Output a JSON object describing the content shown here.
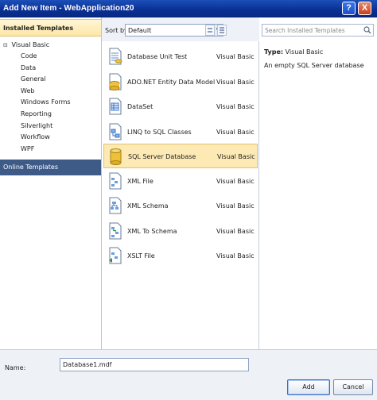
{
  "window": {
    "title": "Add New Item - WebApplication20",
    "help_label": "?",
    "close_label": "X"
  },
  "left": {
    "installed_header": "Installed Templates",
    "tree_root": "Visual Basic",
    "tree_toggle": "⊟",
    "tree_items": [
      "Code",
      "Data",
      "General",
      "Web",
      "Windows Forms",
      "Reporting",
      "Silverlight",
      "Workflow",
      "WPF"
    ],
    "online_templates": "Online Templates"
  },
  "toolbar": {
    "sort_label": "Sort by:",
    "sort_value": "Default",
    "dropdown_glyph": "▼"
  },
  "templates": [
    {
      "name": "Database Unit Test",
      "lang": "Visual Basic",
      "icon": "database-unit-test-icon"
    },
    {
      "name": "ADO.NET Entity Data Model",
      "lang": "Visual Basic",
      "icon": "entity-model-icon"
    },
    {
      "name": "DataSet",
      "lang": "Visual Basic",
      "icon": "dataset-icon"
    },
    {
      "name": "LINQ to SQL Classes",
      "lang": "Visual Basic",
      "icon": "linq-icon"
    },
    {
      "name": "SQL Server Database",
      "lang": "Visual Basic",
      "icon": "sql-database-icon",
      "selected": true
    },
    {
      "name": "XML File",
      "lang": "Visual Basic",
      "icon": "xml-file-icon"
    },
    {
      "name": "XML Schema",
      "lang": "Visual Basic",
      "icon": "xml-schema-icon"
    },
    {
      "name": "XML To Schema",
      "lang": "Visual Basic",
      "icon": "xml-to-schema-icon"
    },
    {
      "name": "XSLT File",
      "lang": "Visual Basic",
      "icon": "xslt-file-icon"
    }
  ],
  "right": {
    "search_placeholder": "Search Installed Templates",
    "type_label": "Type:",
    "type_value": "Visual Basic",
    "description": "An empty SQL Server database"
  },
  "bottom": {
    "name_label": "Name:",
    "name_value": "Database1.mdf",
    "add_label": "Add",
    "cancel_label": "Cancel"
  },
  "colors": {
    "titlebar": "#0a2f94",
    "selection": "#fde9b4",
    "online_bg": "#3e5a86"
  }
}
